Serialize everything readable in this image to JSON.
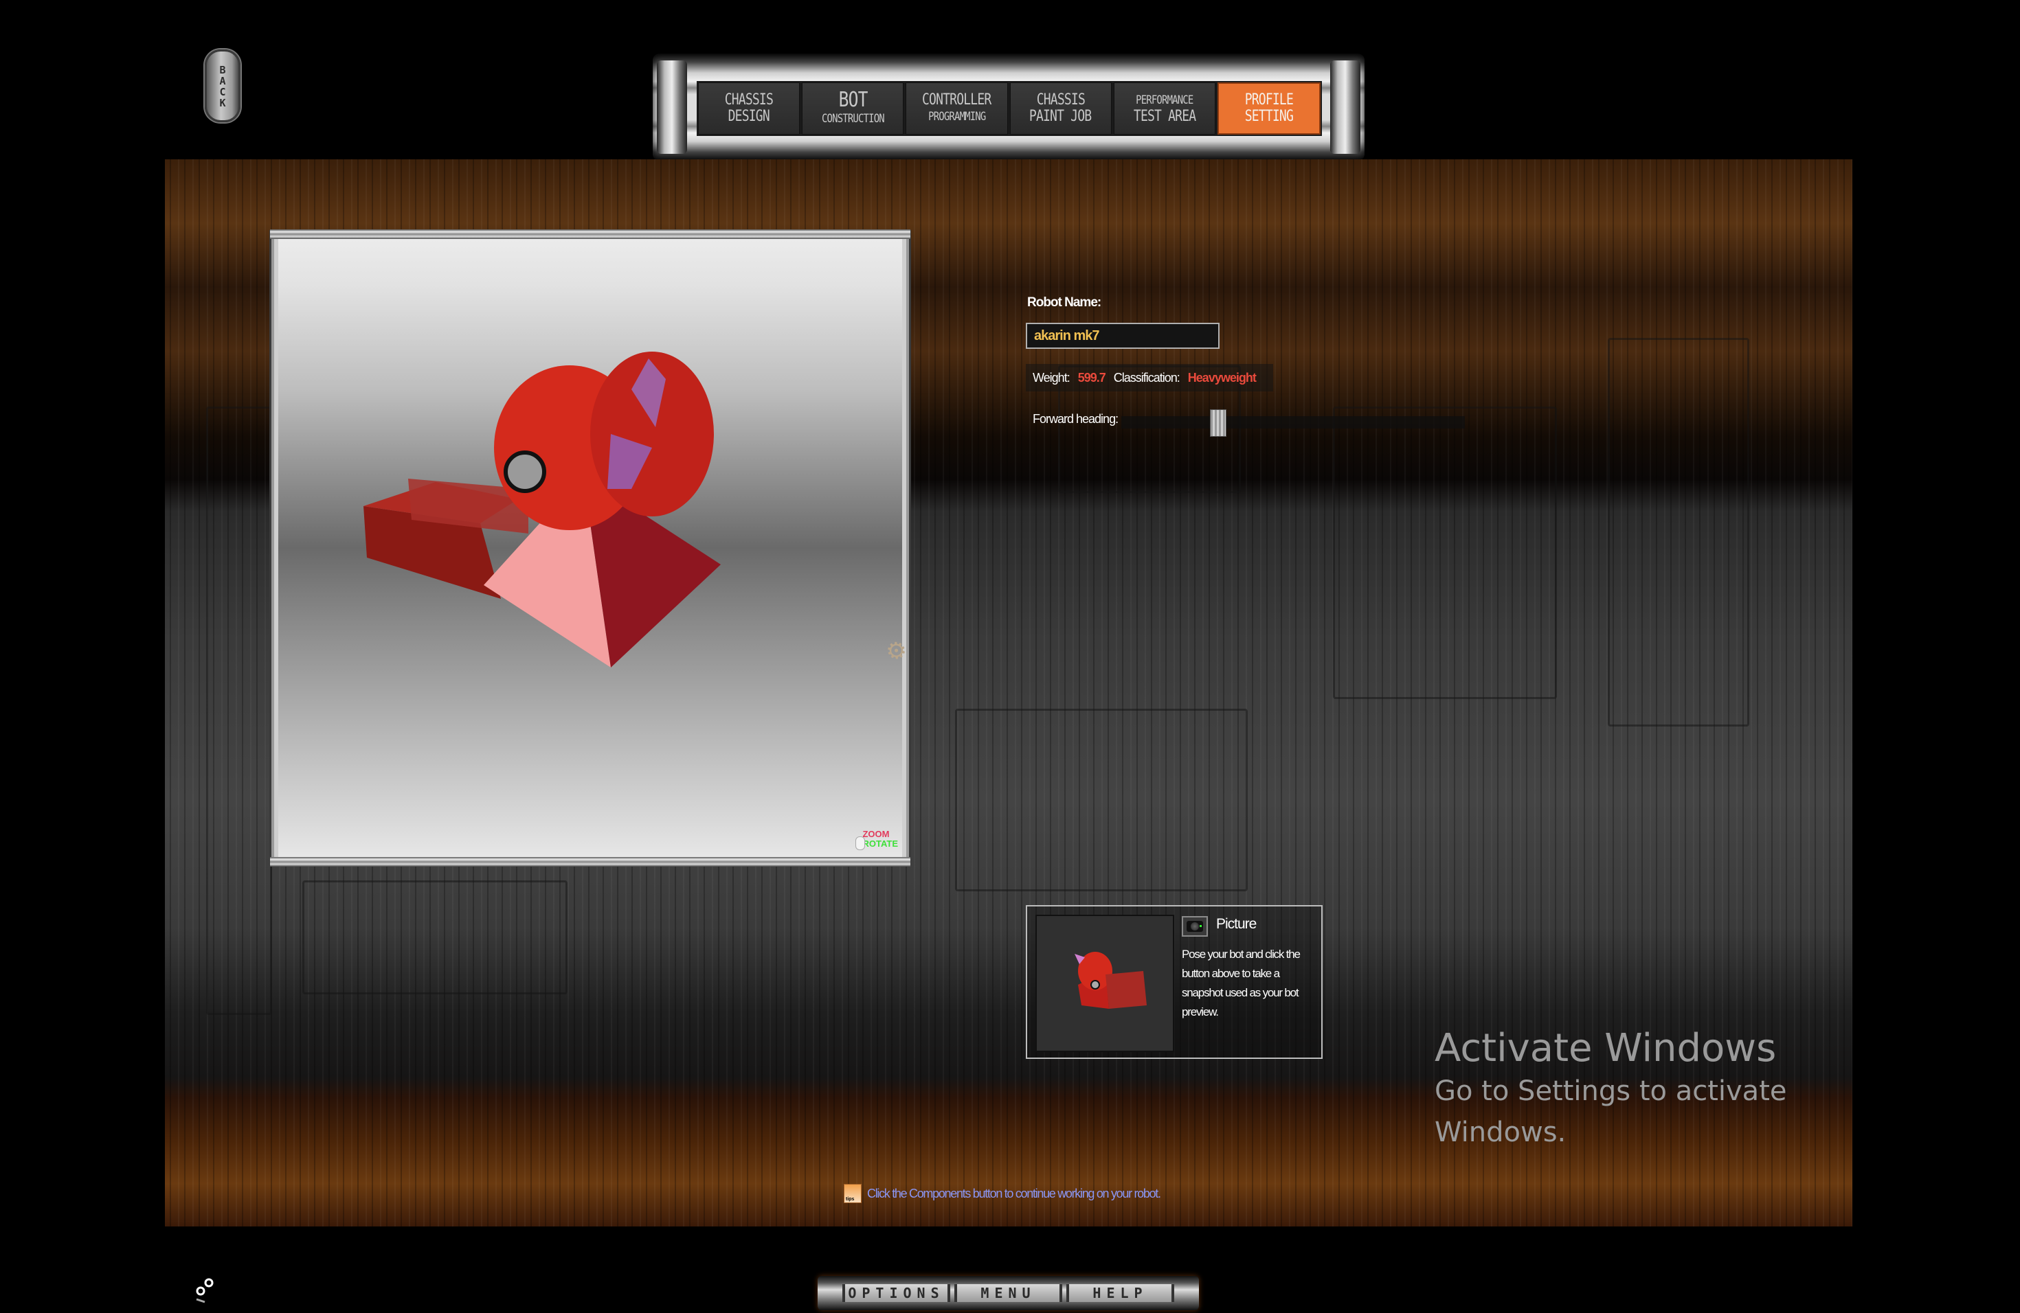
{
  "back_button": {
    "label": "BACK"
  },
  "nav": {
    "tabs": [
      {
        "line1": "CHASSIS",
        "line2": "DESIGN",
        "active": false
      },
      {
        "line1": "BOT",
        "line2": "CONSTRUCTION",
        "active": false
      },
      {
        "line1": "CONTROLLER",
        "line2": "PROGRAMMING",
        "active": false
      },
      {
        "line1": "CHASSIS",
        "line2": "PAINT JOB",
        "active": false
      },
      {
        "line1": "PERFORMANCE",
        "line2": "TEST AREA",
        "active": false
      },
      {
        "line1": "PROFILE",
        "line2": "SETTING",
        "active": true
      }
    ],
    "active_color": "#ea7330"
  },
  "viewport": {
    "zoom_hint": "ZOOM",
    "rotate_hint": "ROTATE"
  },
  "profile": {
    "name_label": "Robot Name:",
    "name_value": "akarin mk7",
    "weight_label": "Weight:",
    "weight_value": "599.7",
    "classification_label": "Classification:",
    "classification_value": "Heavyweight",
    "heading_label": "Forward heading:",
    "heading_slider_fraction": 0.27
  },
  "picture": {
    "title": "Picture",
    "description": "Pose your bot and click the button above to take a snapshot used as your bot preview."
  },
  "tip": {
    "icon_label": "tips",
    "text": "Click the Components button to continue working on your robot."
  },
  "watermark": {
    "title": "Activate Windows",
    "subtitle": "Go to Settings to activate Windows."
  },
  "bottom_bar": {
    "options": "OPTIONS",
    "menu": "MENU",
    "help": "HELP"
  },
  "colors": {
    "accent_orange": "#ea7330",
    "stat_red": "#ea4a3c",
    "name_yellow": "#f1c052",
    "tip_blue": "#8a96f4"
  }
}
